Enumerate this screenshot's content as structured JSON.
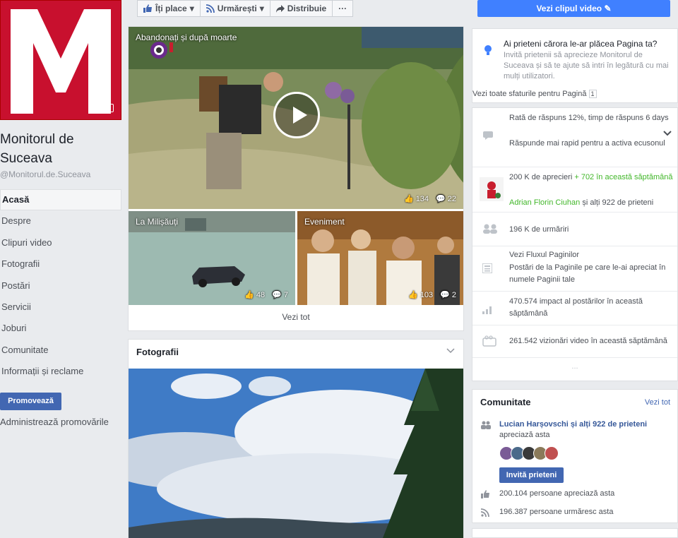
{
  "page": {
    "name": "Monitorul de Suceava",
    "handle": "@Monitorul.de.Suceava",
    "logo_letter": "M",
    "brand_color": "#c8102e",
    "accent_color": "#4267b2"
  },
  "nav": {
    "items": [
      "Acasă",
      "Despre",
      "Clipuri video",
      "Fotografii",
      "Postări",
      "Servicii",
      "Joburi",
      "Comunitate",
      "Informații și reclame"
    ],
    "active": "Acasă",
    "promote_label": "Promovează",
    "admin_promo_label": "Administrează promovările"
  },
  "actions": {
    "like_label": "Îți place",
    "follow_label": "Urmărești",
    "share_label": "Distribuie",
    "more_label": "···",
    "video_button_label": "Vezi clipul video"
  },
  "videos": {
    "main": {
      "title": "Abandonați și după moarte",
      "likes": "134",
      "comments": "22"
    },
    "second": {
      "title": "La Milișăuți",
      "likes": "48",
      "comments": "7"
    },
    "third": {
      "title": "Eveniment",
      "likes": "103",
      "comments": "2"
    },
    "see_all": "Vezi tot"
  },
  "photos": {
    "title": "Fotografii"
  },
  "tip": {
    "title": "Ai prieteni cărora le-ar plăcea Pagina ta?",
    "text": "Invită prietenii să aprecieze Monitorul de Suceava și să te ajute să intri în legătură cu mai mulți utilizatori.",
    "link": "Vezi toate sfaturile pentru Pagină",
    "badge": "1"
  },
  "info": {
    "response_line1": "Rată de răspuns 12%, timp de răspuns 6 days",
    "response_line2": "Răspunde mai rapid pentru a activa ecusonul",
    "likes_text": "200 K de aprecieri",
    "likes_week": "+ 702 în această săptămână",
    "likes_friends_name": "Adrian Florin Ciuhan",
    "likes_friends_rest": "și alți 922 de prieteni",
    "follows_text": "196 K de urmăriri",
    "feed_title": "Vezi Fluxul Paginilor",
    "feed_text": "Postări de la Paginile pe care le-ai apreciat în numele Paginii tale",
    "impact_text": "470.574 impact al postărilor în această săptămână",
    "views_text": "261.542 vizionări video în această săptămână",
    "more": "..."
  },
  "community": {
    "title": "Comunitate",
    "see_all": "Vezi tot",
    "friends_name": "Lucian Harșovschi",
    "friends_rest": "și alți 922 de prieteni",
    "friends_suffix": "apreciază asta",
    "invite_label": "Invită prieteni",
    "likes_line": "200.104 persoane apreciază asta",
    "follows_line": "196.387 persoane urmăresc asta"
  }
}
